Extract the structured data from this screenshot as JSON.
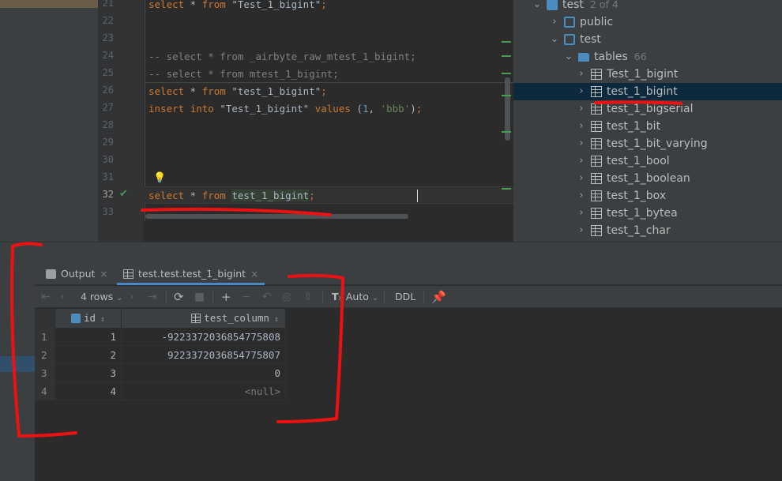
{
  "editor": {
    "lines": [
      {
        "n": "21",
        "html": [
          [
            "kw",
            "select"
          ],
          [
            "",
            " * "
          ],
          [
            "kw",
            "from"
          ],
          [
            "",
            " \"Test_1_bigint\""
          ],
          [
            "kw",
            ";"
          ]
        ]
      },
      {
        "n": "22",
        "html": []
      },
      {
        "n": "23",
        "html": []
      },
      {
        "n": "24",
        "html": [
          [
            "cmt",
            "-- select * from _airbyte_raw_mtest_1_bigint;"
          ]
        ]
      },
      {
        "n": "25",
        "html": [
          [
            "cmt",
            "-- select * from mtest_1_bigint;"
          ]
        ]
      },
      {
        "n": "26",
        "html": [
          [
            "kw",
            "select"
          ],
          [
            "",
            " * "
          ],
          [
            "kw",
            "from"
          ],
          [
            "",
            " \"test_1_bigint\""
          ],
          [
            "kw",
            ";"
          ]
        ]
      },
      {
        "n": "27",
        "html": [
          [
            "kw",
            "insert"
          ],
          [
            "",
            " "
          ],
          [
            "kw",
            "into"
          ],
          [
            "",
            " \"Test_1_bigint\" "
          ],
          [
            "kw",
            "values"
          ],
          [
            "",
            " ("
          ],
          [
            "num",
            "1"
          ],
          [
            "",
            ", "
          ],
          [
            "strg",
            "'bbb'"
          ],
          [
            "",
            ")"
          ],
          [
            "kw",
            ";"
          ]
        ]
      },
      {
        "n": "28",
        "html": []
      },
      {
        "n": "29",
        "html": []
      },
      {
        "n": "30",
        "html": []
      },
      {
        "n": "31",
        "html": []
      },
      {
        "n": "32",
        "html": [
          [
            "kw",
            "select"
          ],
          [
            "",
            " * "
          ],
          [
            "kw",
            "from"
          ],
          [
            "",
            " "
          ],
          [
            "hl",
            "test_1_bigint"
          ],
          [
            "kw",
            ";"
          ]
        ]
      },
      {
        "n": "33",
        "html": []
      }
    ]
  },
  "tree": {
    "rows": [
      {
        "indent": 1,
        "arrow": "down",
        "icon": "db",
        "label": "test",
        "meta": "2 of 4"
      },
      {
        "indent": 2,
        "arrow": "right",
        "icon": "schema",
        "label": "public",
        "meta": ""
      },
      {
        "indent": 2,
        "arrow": "down",
        "icon": "schema",
        "label": "test",
        "meta": ""
      },
      {
        "indent": 3,
        "arrow": "down",
        "icon": "folder",
        "label": "tables",
        "meta": "66"
      },
      {
        "indent": 4,
        "arrow": "right",
        "icon": "table",
        "label": "Test_1_bigint",
        "meta": ""
      },
      {
        "indent": 4,
        "arrow": "right",
        "icon": "table",
        "label": "test_1_bigint",
        "meta": "",
        "selected": true
      },
      {
        "indent": 4,
        "arrow": "right",
        "icon": "table",
        "label": "test_1_bigserial",
        "meta": ""
      },
      {
        "indent": 4,
        "arrow": "right",
        "icon": "table",
        "label": "test_1_bit",
        "meta": ""
      },
      {
        "indent": 4,
        "arrow": "right",
        "icon": "table",
        "label": "test_1_bit_varying",
        "meta": ""
      },
      {
        "indent": 4,
        "arrow": "right",
        "icon": "table",
        "label": "test_1_bool",
        "meta": ""
      },
      {
        "indent": 4,
        "arrow": "right",
        "icon": "table",
        "label": "test_1_boolean",
        "meta": ""
      },
      {
        "indent": 4,
        "arrow": "right",
        "icon": "table",
        "label": "test_1_box",
        "meta": ""
      },
      {
        "indent": 4,
        "arrow": "right",
        "icon": "table",
        "label": "test_1_bytea",
        "meta": ""
      },
      {
        "indent": 4,
        "arrow": "right",
        "icon": "table",
        "label": "test_1_char",
        "meta": ""
      }
    ]
  },
  "results": {
    "tabs": [
      {
        "label": "Output",
        "icon": "output-icon"
      },
      {
        "label": "test.test.test_1_bigint",
        "icon": "table-icon"
      }
    ],
    "toolbar": {
      "rows_label": "4 rows",
      "mode_label": "Auto",
      "ddl_label": "DDL"
    },
    "columns": [
      "id",
      "test_column"
    ],
    "rows": [
      {
        "n": "1",
        "id": "1",
        "value": "-9223372036854775808"
      },
      {
        "n": "2",
        "id": "2",
        "value": "9223372036854775807"
      },
      {
        "n": "3",
        "id": "3",
        "value": "0"
      },
      {
        "n": "4",
        "id": "4",
        "value": "<null>"
      }
    ]
  },
  "colors": {
    "keyword": "#cc7832",
    "string": "#6a8759",
    "number": "#6897bb",
    "comment": "#808080",
    "selection": "#0d293e",
    "annotation": "#ee1111"
  }
}
